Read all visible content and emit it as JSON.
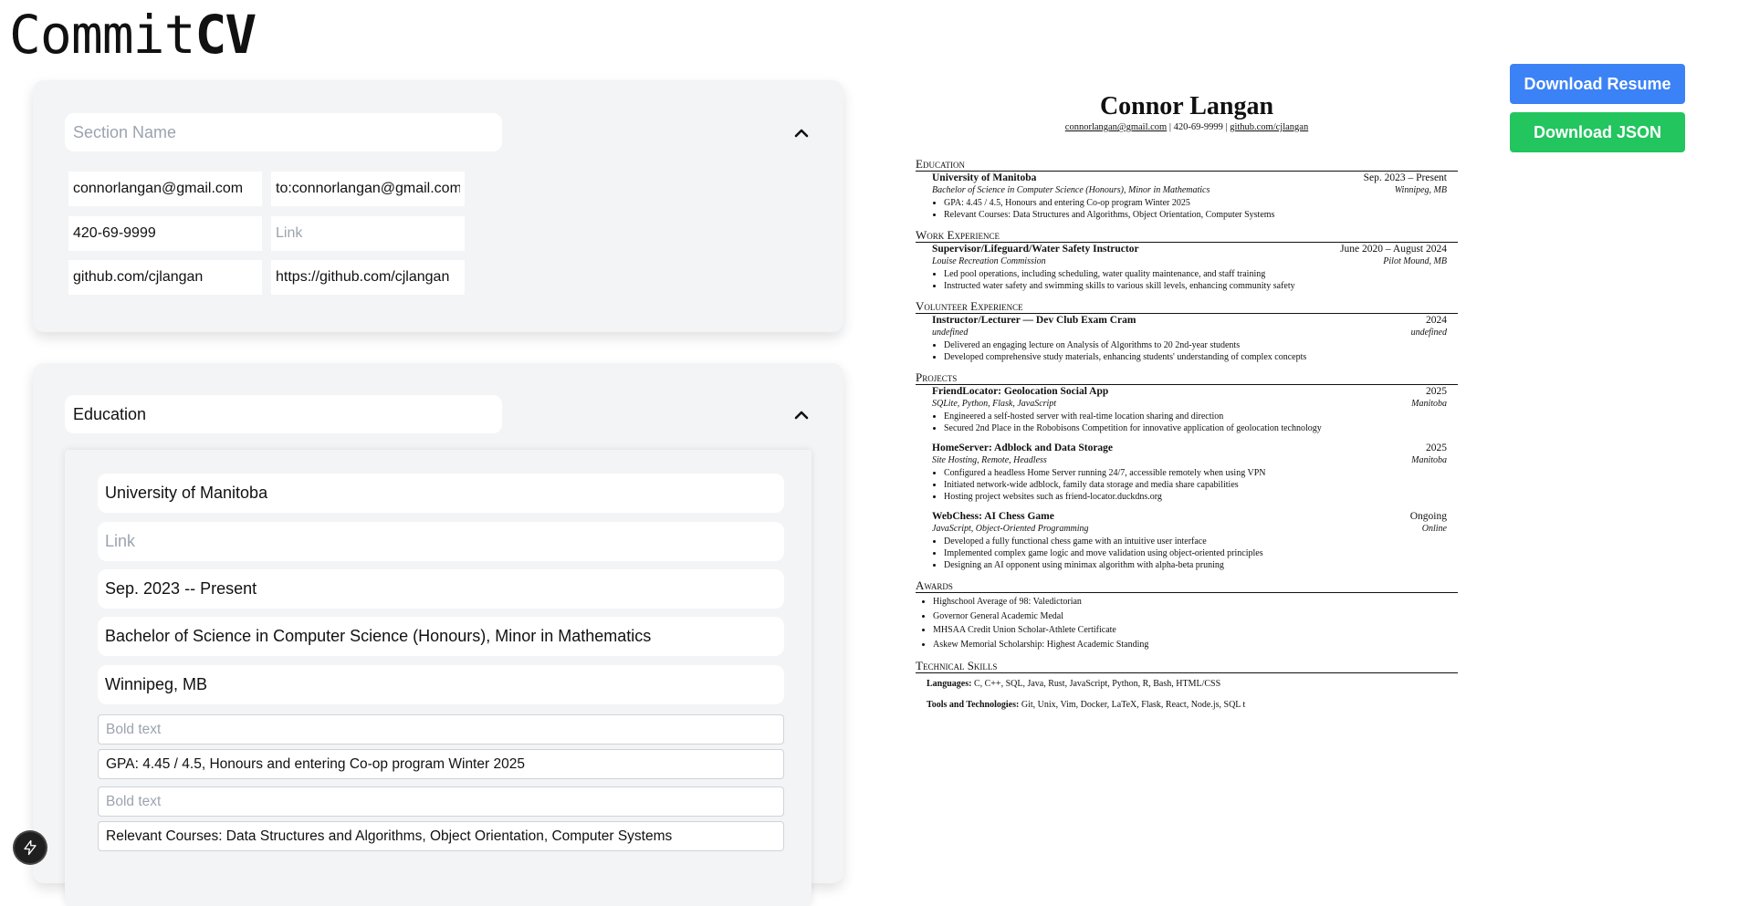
{
  "logo": {
    "light": "Commit",
    "bold": "CV"
  },
  "contact_card": {
    "section_placeholder": "Section Name",
    "rows": [
      {
        "label": "connorlangan@gmail.com",
        "link": "to:connorlangan@gmail.com",
        "link_placeholder": "Link"
      },
      {
        "label": "420-69-9999",
        "link": "",
        "link_placeholder": "Link"
      },
      {
        "label": "github.com/cjlangan",
        "link": "https://github.com/cjlangan",
        "link_placeholder": "Link"
      }
    ]
  },
  "education_card": {
    "section_name": "Education",
    "section_placeholder": "Section Name",
    "entry": {
      "title": "University of Manitoba",
      "link_placeholder": "Link",
      "date": "Sep. 2023 -- Present",
      "subtitle": "Bachelor of Science in Computer Science (Honours), Minor in Mathematics",
      "location": "Winnipeg, MB",
      "bold_placeholder": "Bold text",
      "bullets": [
        "GPA: 4.45 / 4.5, Honours and entering Co-op program Winter 2025",
        "Relevant Courses: Data Structures and Algorithms, Object Orientation, Computer Systems"
      ]
    }
  },
  "buttons": {
    "download_resume": "Download Resume",
    "download_json": "Download JSON"
  },
  "resume": {
    "name": "Connor Langan",
    "contact": [
      "connorlangan@gmail.com",
      "420-69-9999",
      "github.com/cjlangan"
    ],
    "contact_separator": "|",
    "education": {
      "heading": "Education",
      "title": "University of Manitoba",
      "date": "Sep. 2023 – Present",
      "subtitle": "Bachelor of Science in Computer Science (Honours), Minor in Mathematics",
      "location": "Winnipeg, MB",
      "bullets": [
        "GPA: 4.45 / 4.5, Honours and entering Co-op program Winter 2025",
        "Relevant Courses: Data Structures and Algorithms, Object Orientation, Computer Systems"
      ]
    },
    "work": {
      "heading": "Work Experience",
      "title": "Supervisor/Lifeguard/Water Safety Instructor",
      "date": "June 2020 – August 2024",
      "subtitle": "Louise Recreation Commission",
      "location": "Pilot Mound, MB",
      "bullets": [
        "Led pool operations, including scheduling, water quality maintenance, and staff training",
        "Instructed water safety and swimming skills to various skill levels, enhancing community safety"
      ]
    },
    "volunteer": {
      "heading": "Volunteer Experience",
      "title": "Instructor/Lecturer — Dev Club Exam Cram",
      "date": "2024",
      "subtitle": "undefined",
      "location": "undefined",
      "bullets": [
        "Delivered an engaging lecture on Analysis of Algorithms to 20 2nd-year students",
        "Developed comprehensive study materials, enhancing students' understanding of complex concepts"
      ]
    },
    "projects": {
      "heading": "Projects",
      "items": [
        {
          "title": "FriendLocator: Geolocation Social App",
          "date": "2025",
          "subtitle": "SQLite, Python, Flask, JavaScript",
          "location": "Manitoba",
          "bullets": [
            "Engineered a self-hosted server with real-time location sharing and direction",
            "Secured 2nd Place in the Robobisons Competition for innovative application of geolocation technology"
          ]
        },
        {
          "title": "HomeServer: Adblock and Data Storage",
          "date": "2025",
          "subtitle": "Site Hosting, Remote, Headless",
          "location": "Manitoba",
          "bullets": [
            "Configured a headless Home Server running 24/7, accessible remotely when using VPN",
            "Initiated network-wide adblock, family data storage and media share capabilities",
            "Hosting project websites such as friend-locator.duckdns.org"
          ]
        },
        {
          "title": "WebChess: AI Chess Game",
          "date": "Ongoing",
          "subtitle": "JavaScript, Object-Oriented Programming",
          "location": "Online",
          "bullets": [
            "Developed a fully functional chess game with an intuitive user interface",
            "Implemented complex game logic and move validation using object-oriented principles",
            "Designing an AI opponent using minimax algorithm with alpha-beta pruning"
          ]
        }
      ]
    },
    "awards": {
      "heading": "Awards",
      "items": [
        "Highschool Average of 98: Valedictorian",
        "Governor General Academic Medal",
        "MHSAA Credit Union Scholar-Athlete Certificate",
        "Askew Memorial Scholarship: Highest Academic Standing"
      ]
    },
    "skills": {
      "heading": "Technical Skills",
      "languages_label": "Languages:",
      "languages": "C, C++, SQL, Java, Rust, JavaScript, Python, R, Bash, HTML/CSS",
      "tools_label": "Tools and Technologies:",
      "tools": "Git, Unix, Vim, Docker, LaTeX, Flask, React, Node.js, SQL t"
    }
  }
}
